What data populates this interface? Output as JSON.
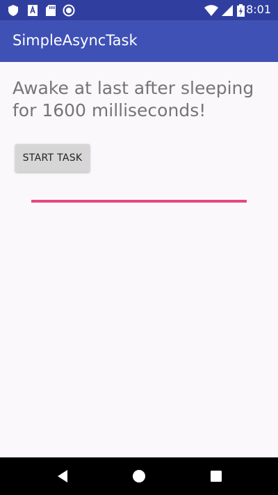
{
  "status_bar": {
    "time": "8:01",
    "left_icons": [
      "shield-icon",
      "text-app-icon",
      "sd-card-icon",
      "radio-circle-icon"
    ],
    "right_icons": [
      "wifi-icon",
      "signal-icon",
      "battery-charging-icon"
    ]
  },
  "app_bar": {
    "title": "SimpleAsyncTask"
  },
  "main": {
    "message": "Awake at last after sleeping for 1600 milliseconds!",
    "start_button_label": "START TASK",
    "progress": 1.0
  },
  "nav_bar": {
    "buttons": [
      "back-icon",
      "home-icon",
      "recents-icon"
    ]
  },
  "colors": {
    "status_bar": "#303F9F",
    "app_bar": "#3F51B5",
    "accent": "#E7477F",
    "background": "#FAF8FB",
    "button": "#D6D6D6"
  }
}
